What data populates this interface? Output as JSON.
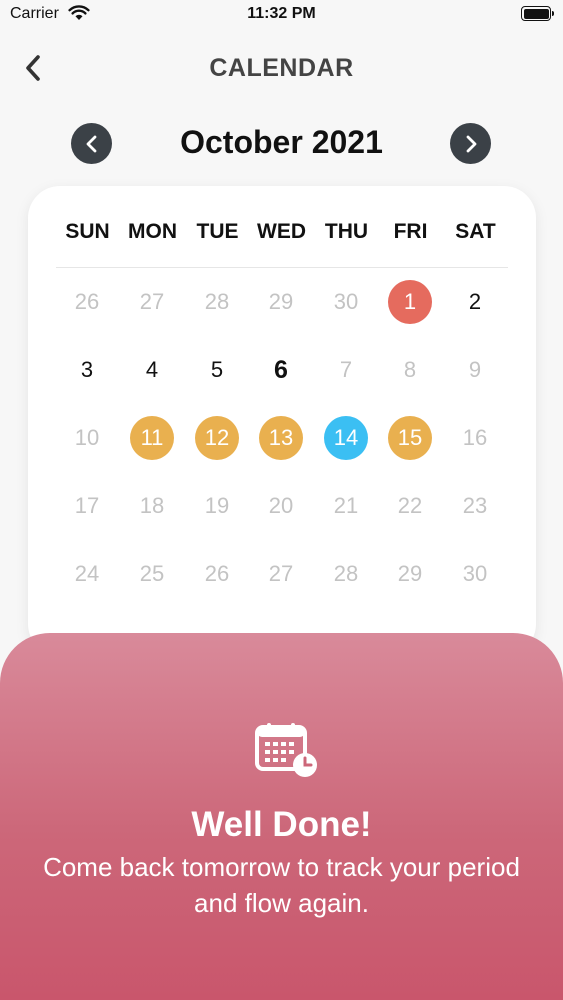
{
  "status_bar": {
    "carrier": "Carrier",
    "time": "11:32 PM"
  },
  "nav": {
    "title": "CALENDAR",
    "back_icon": "chevron-left-icon"
  },
  "month": {
    "label": "October 2021",
    "prev_icon": "chevron-left-icon",
    "next_icon": "chevron-right-icon"
  },
  "calendar": {
    "weekdays": [
      "SUN",
      "MON",
      "TUE",
      "WED",
      "THU",
      "FRI",
      "SAT"
    ],
    "weeks": [
      [
        {
          "d": "26",
          "s": "muted"
        },
        {
          "d": "27",
          "s": "muted"
        },
        {
          "d": "28",
          "s": "muted"
        },
        {
          "d": "29",
          "s": "muted"
        },
        {
          "d": "30",
          "s": "muted"
        },
        {
          "d": "1",
          "s": "period"
        },
        {
          "d": "2",
          "s": "normal"
        }
      ],
      [
        {
          "d": "3",
          "s": "normal"
        },
        {
          "d": "4",
          "s": "normal"
        },
        {
          "d": "5",
          "s": "normal"
        },
        {
          "d": "6",
          "s": "today"
        },
        {
          "d": "7",
          "s": "muted"
        },
        {
          "d": "8",
          "s": "muted"
        },
        {
          "d": "9",
          "s": "muted"
        }
      ],
      [
        {
          "d": "10",
          "s": "muted"
        },
        {
          "d": "11",
          "s": "fertile"
        },
        {
          "d": "12",
          "s": "fertile"
        },
        {
          "d": "13",
          "s": "fertile"
        },
        {
          "d": "14",
          "s": "ovulation"
        },
        {
          "d": "15",
          "s": "fertile"
        },
        {
          "d": "16",
          "s": "muted"
        }
      ],
      [
        {
          "d": "17",
          "s": "muted"
        },
        {
          "d": "18",
          "s": "muted"
        },
        {
          "d": "19",
          "s": "muted"
        },
        {
          "d": "20",
          "s": "muted"
        },
        {
          "d": "21",
          "s": "muted"
        },
        {
          "d": "22",
          "s": "muted"
        },
        {
          "d": "23",
          "s": "muted"
        }
      ],
      [
        {
          "d": "24",
          "s": "muted"
        },
        {
          "d": "25",
          "s": "muted"
        },
        {
          "d": "26",
          "s": "muted"
        },
        {
          "d": "27",
          "s": "muted"
        },
        {
          "d": "28",
          "s": "muted"
        },
        {
          "d": "29",
          "s": "muted"
        },
        {
          "d": "30",
          "s": "muted"
        }
      ]
    ]
  },
  "colors": {
    "period": "#e56b5e",
    "fertile": "#e9b04f",
    "ovulation": "#3bbff3",
    "nav_button": "#3b4147",
    "sheet_top": "#d98a9a",
    "sheet_bottom": "#c9566c"
  },
  "sheet": {
    "icon": "calendar-clock-icon",
    "title": "Well Done!",
    "message": "Come back tomorrow to track your period and flow again."
  }
}
